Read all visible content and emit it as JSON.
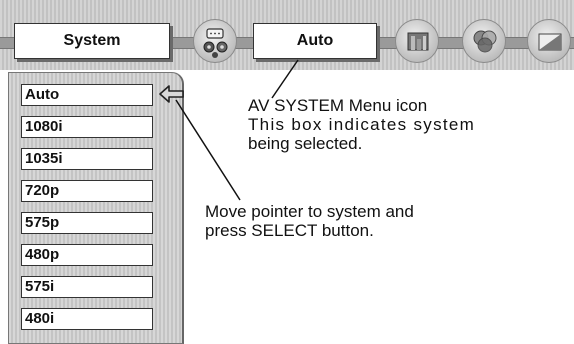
{
  "menu_bar": {
    "system_label": "System",
    "selected_label": "Auto",
    "icons": [
      "av-system-menu-icon",
      "image-menu-icon",
      "color-menu-icon",
      "screen-menu-icon"
    ]
  },
  "system_list": {
    "items": [
      "Auto",
      "1080i",
      "1035i",
      "720p",
      "575p",
      "480p",
      "575i",
      "480i"
    ],
    "pointer_icon": "arrow-left-icon"
  },
  "annotations": {
    "icon_note_line1": "AV SYSTEM Menu icon",
    "icon_note_line2": "This box indicates system",
    "icon_note_line3": "being selected.",
    "pointer_note_line1": "Move pointer to system and",
    "pointer_note_line2": "press SELECT button."
  },
  "colors": {
    "panel_gray": "#cfcfcf",
    "box_fill": "#ffffff",
    "text": "#111111"
  }
}
